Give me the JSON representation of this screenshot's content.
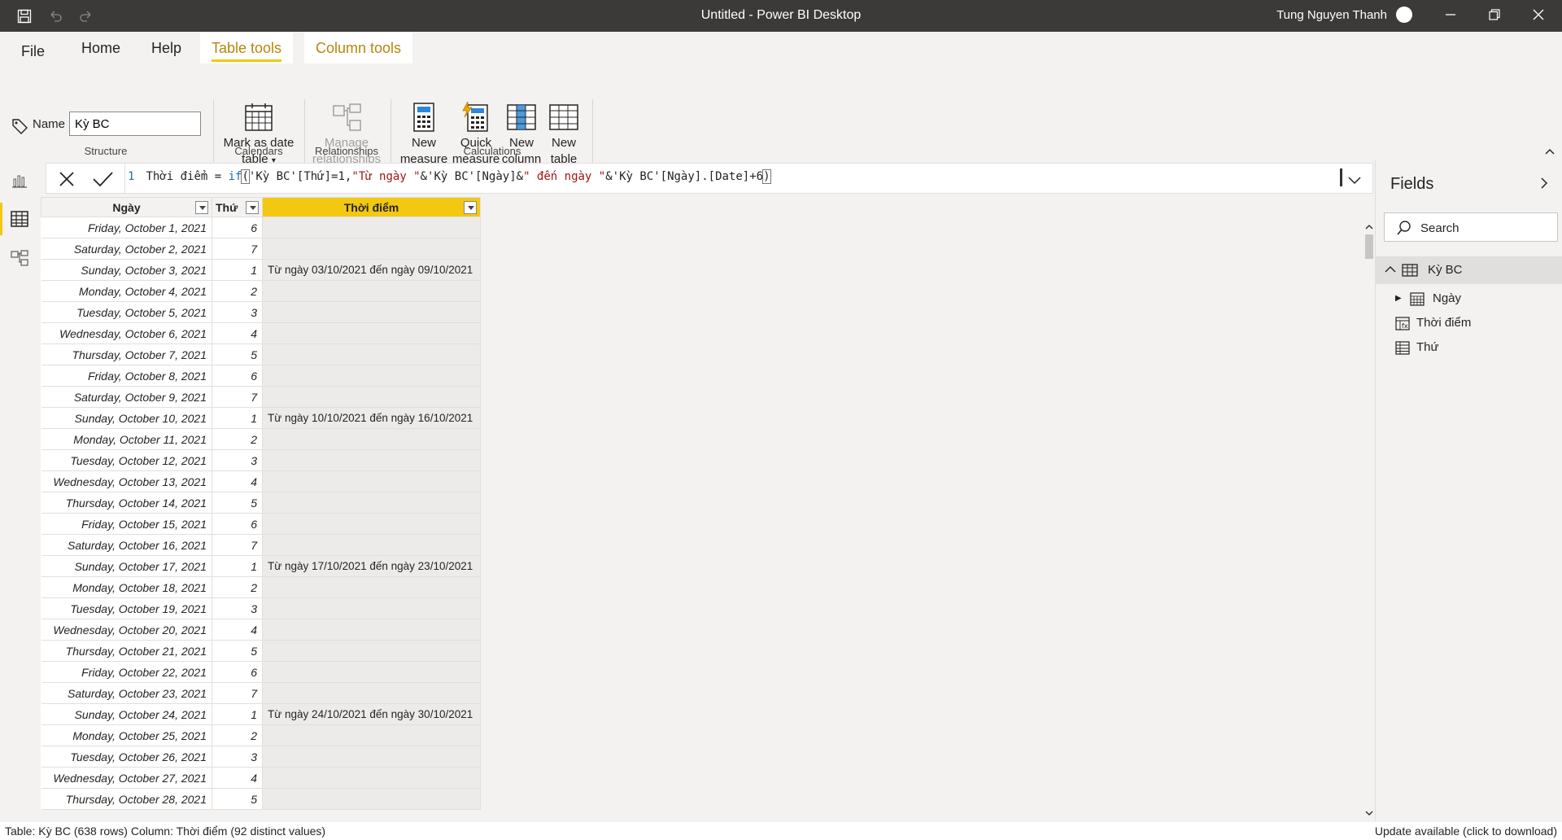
{
  "window": {
    "title": "Untitled - Power BI Desktop",
    "user": "Tung Nguyen Thanh"
  },
  "ribbon": {
    "tabs": [
      {
        "label": "File"
      },
      {
        "label": "Home"
      },
      {
        "label": "Help"
      },
      {
        "label": "Table tools"
      },
      {
        "label": "Column tools"
      }
    ],
    "structure": {
      "name_label": "Name",
      "name_value": "Kỳ BC",
      "group_label": "Structure"
    },
    "calendars": {
      "mark_as_date_line1": "Mark as date",
      "mark_as_date_line2": "table",
      "group_label": "Calendars"
    },
    "relationships": {
      "manage_line1": "Manage",
      "manage_line2": "relationships",
      "group_label": "Relationships"
    },
    "calculations": {
      "new_measure_line1": "New",
      "new_measure_line2": "measure",
      "quick_measure_line1": "Quick",
      "quick_measure_line2": "measure",
      "new_column_line1": "New",
      "new_column_line2": "column",
      "new_table_line1": "New",
      "new_table_line2": "table",
      "group_label": "Calculations"
    }
  },
  "formula": {
    "line_number": "1",
    "part1": "Thời điểm = ",
    "fn": "if",
    "part2": "'Kỳ BC'[Thứ]=1,",
    "str1": "\"Từ ngày \"",
    "part3": "&'Kỳ BC'[Ngày]&",
    "str2": "\" đến ngày \"",
    "part4": "&'Kỳ BC'[Ngày].[Date]+6"
  },
  "table": {
    "headers": [
      "Ngày",
      "Thứ",
      "Thời điểm"
    ],
    "rows": [
      [
        "Friday, October 1, 2021",
        "6",
        ""
      ],
      [
        "Saturday, October 2, 2021",
        "7",
        ""
      ],
      [
        "Sunday, October 3, 2021",
        "1",
        "Từ ngày 03/10/2021 đến ngày 09/10/2021"
      ],
      [
        "Monday, October 4, 2021",
        "2",
        ""
      ],
      [
        "Tuesday, October 5, 2021",
        "3",
        ""
      ],
      [
        "Wednesday, October 6, 2021",
        "4",
        ""
      ],
      [
        "Thursday, October 7, 2021",
        "5",
        ""
      ],
      [
        "Friday, October 8, 2021",
        "6",
        ""
      ],
      [
        "Saturday, October 9, 2021",
        "7",
        ""
      ],
      [
        "Sunday, October 10, 2021",
        "1",
        "Từ ngày 10/10/2021 đến ngày 16/10/2021"
      ],
      [
        "Monday, October 11, 2021",
        "2",
        ""
      ],
      [
        "Tuesday, October 12, 2021",
        "3",
        ""
      ],
      [
        "Wednesday, October 13, 2021",
        "4",
        ""
      ],
      [
        "Thursday, October 14, 2021",
        "5",
        ""
      ],
      [
        "Friday, October 15, 2021",
        "6",
        ""
      ],
      [
        "Saturday, October 16, 2021",
        "7",
        ""
      ],
      [
        "Sunday, October 17, 2021",
        "1",
        "Từ ngày 17/10/2021 đến ngày 23/10/2021"
      ],
      [
        "Monday, October 18, 2021",
        "2",
        ""
      ],
      [
        "Tuesday, October 19, 2021",
        "3",
        ""
      ],
      [
        "Wednesday, October 20, 2021",
        "4",
        ""
      ],
      [
        "Thursday, October 21, 2021",
        "5",
        ""
      ],
      [
        "Friday, October 22, 2021",
        "6",
        ""
      ],
      [
        "Saturday, October 23, 2021",
        "7",
        ""
      ],
      [
        "Sunday, October 24, 2021",
        "1",
        "Từ ngày 24/10/2021 đến ngày 30/10/2021"
      ],
      [
        "Monday, October 25, 2021",
        "2",
        ""
      ],
      [
        "Tuesday, October 26, 2021",
        "3",
        ""
      ],
      [
        "Wednesday, October 27, 2021",
        "4",
        ""
      ],
      [
        "Thursday, October 28, 2021",
        "5",
        ""
      ]
    ]
  },
  "fields": {
    "title": "Fields",
    "search_placeholder": "Search",
    "table_name": "Kỳ BC",
    "items": [
      {
        "label": "Ngày",
        "icon": "calendar-icon"
      },
      {
        "label": "Thời điểm",
        "icon": "calculated-column-icon"
      },
      {
        "label": "Thứ",
        "icon": "column-icon"
      }
    ]
  },
  "status": {
    "left": "Table: Kỳ BC (638 rows) Column: Thời điểm (92 distinct values)",
    "right": "Update available (click to download)"
  },
  "colors": {
    "accent": "#f2c811",
    "titlebar": "#3b3a39",
    "contextual_tab_text": "#b8860b"
  }
}
